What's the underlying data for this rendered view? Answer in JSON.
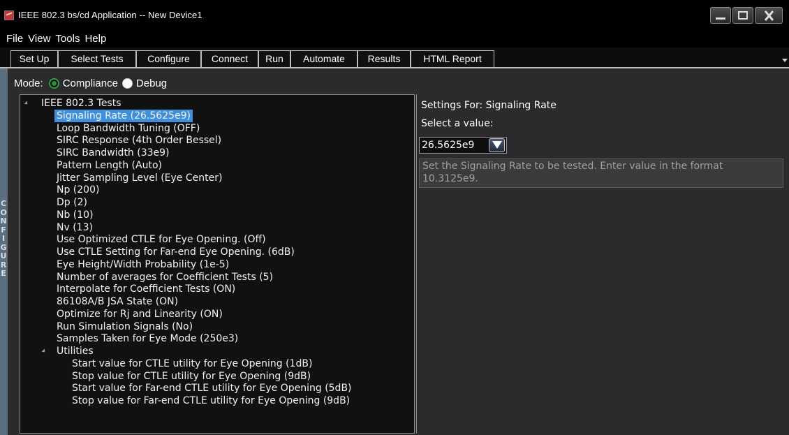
{
  "window": {
    "title": "IEEE 802.3 bs/cd Application -- New Device1"
  },
  "menu": [
    "File",
    "View",
    "Tools",
    "Help"
  ],
  "tabs": [
    "Set Up",
    "Select Tests",
    "Configure",
    "Connect",
    "Run",
    "Automate",
    "Results",
    "HTML Report"
  ],
  "side_label": "CONFIGURE",
  "mode": {
    "label": "Mode:",
    "options": [
      "Compliance",
      "Debug"
    ],
    "selected": "Compliance"
  },
  "tree": {
    "root": "IEEE 802.3 Tests",
    "selected_index": 0,
    "items": [
      "Signaling Rate (26.5625e9)",
      "Loop Bandwidth Tuning (OFF)",
      "SIRC Response (4th Order Bessel)",
      "SIRC Bandwidth (33e9)",
      "Pattern Length (Auto)",
      "Jitter Sampling Level (Eye Center)",
      "Np (200)",
      "Dp (2)",
      "Nb (10)",
      "Nv (13)",
      "Use Optimized CTLE for Eye Opening. (Off)",
      "Use CTLE Setting for Far-end Eye Opening. (6dB)",
      "Eye Height/Width Probability (1e-5)",
      "Number of averages for Coefficient Tests (5)",
      "Interpolate for Coefficient Tests (ON)",
      "86108A/B JSA State (ON)",
      "Optimize for Rj and Linearity (ON)",
      "Run Simulation Signals (No)",
      "Samples Taken for Eye Mode (250e3)"
    ],
    "group": {
      "label": "Utilities",
      "items": [
        "Start value for CTLE utility for Eye Opening (1dB)",
        "Stop value for CTLE utility for Eye Opening (9dB)",
        "Start value for Far-end CTLE utility for Eye Opening (5dB)",
        "Stop value for Far-end CTLE utility for Eye Opening (9dB)"
      ]
    }
  },
  "settings": {
    "title": "Settings For: Signaling Rate",
    "select_label": "Select a value:",
    "value": "26.5625e9",
    "help": "Set the Signaling Rate to be tested. Enter value in the format 10.3125e9."
  },
  "colors": {
    "selection": "#3e8fde",
    "radio_selected": "#2ea043",
    "side_label_bg": "#5b6f82"
  }
}
